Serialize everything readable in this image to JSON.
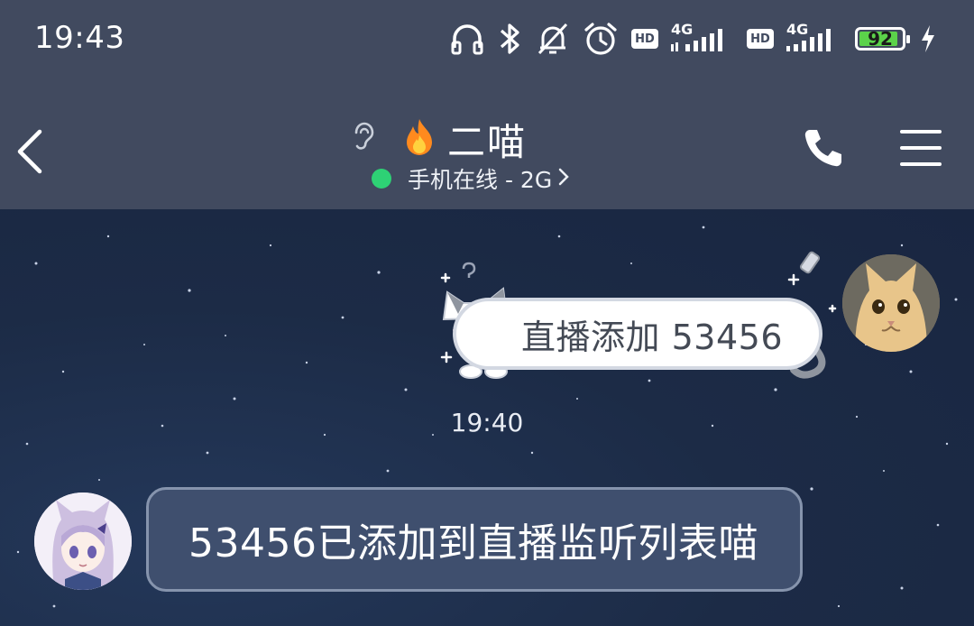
{
  "status_bar": {
    "time": "19:43",
    "network_label_1": "4G",
    "network_label_2": "4G",
    "hd_label": "HD",
    "battery_percent": "92",
    "battery_level": 0.92,
    "icons": [
      "headphones-icon",
      "bluetooth-icon",
      "bell-muted-icon",
      "alarm-icon",
      "hd-icon",
      "signal-icon",
      "hd-icon",
      "signal-icon",
      "battery-icon",
      "charging-icon"
    ]
  },
  "header": {
    "contact_name": "二喵",
    "presence_text": "手机在线 - 2G",
    "presence_color": "#2ed175",
    "icons": [
      "back-icon",
      "ear-icon",
      "fire-icon",
      "phone-icon",
      "menu-icon"
    ]
  },
  "chat": {
    "messages": [
      {
        "direction": "outgoing",
        "text": "直播添加 53456"
      },
      {
        "direction": "incoming",
        "text": "53456已添加到直播监听列表喵"
      }
    ],
    "timestamp": "19:40",
    "bubble_in_color": "#3f4f6e",
    "bubble_out_color": "#ffffff"
  }
}
